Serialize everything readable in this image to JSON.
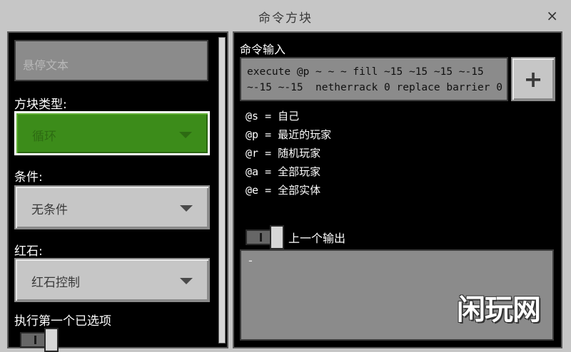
{
  "window": {
    "title": "命令方块",
    "close_symbol": "×"
  },
  "left": {
    "hover_text_placeholder": "悬停文本",
    "block_type_label": "方块类型:",
    "block_type_value": "循环",
    "condition_label": "条件:",
    "condition_value": "无条件",
    "redstone_label": "红石:",
    "redstone_value": "红石控制",
    "execute_first_label": "执行第一个已选项"
  },
  "right": {
    "command_input_label": "命令输入",
    "command_line1": "execute @p ~ ~ ~ fill ~15 ~15 ~15 ~-15",
    "command_line2": "~-15 ~-15  netherrack 0 replace barrier 0",
    "plus_label": "+",
    "selectors": [
      "@s = 自己",
      "@p = 最近的玩家",
      "@r = 随机玩家",
      "@a = 全部玩家",
      "@e = 全部实体"
    ],
    "previous_output_label": "上一个输出",
    "output_text": "-"
  },
  "colors": {
    "block_type_green": "#3c8c1a",
    "panel_black": "#000000",
    "gui_gray": "#c6c6c6"
  },
  "watermark": "闲玩网"
}
